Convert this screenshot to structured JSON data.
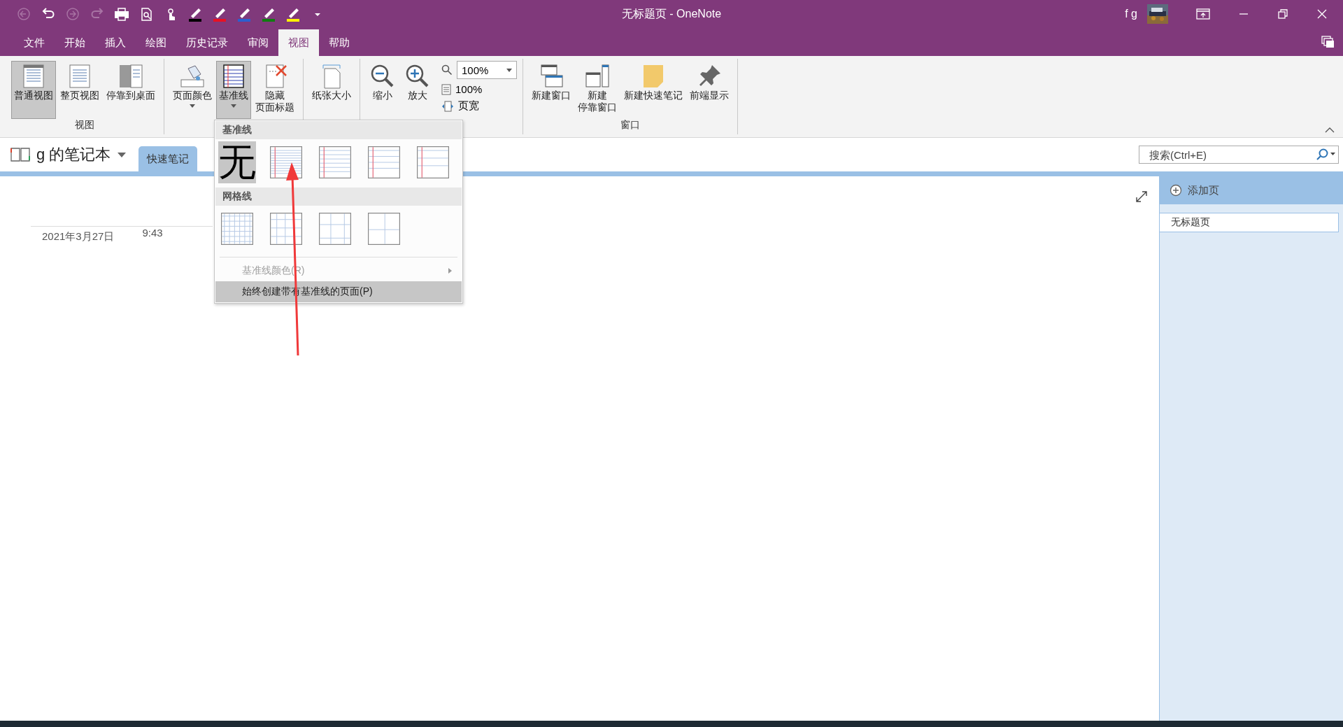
{
  "window": {
    "title": "无标题页 - OneNote",
    "user": "f g"
  },
  "quick_access": [
    {
      "kind": "back",
      "disabled": true
    },
    {
      "kind": "undo",
      "disabled": false
    },
    {
      "kind": "forward",
      "disabled": true
    },
    {
      "kind": "redo",
      "disabled": true
    },
    {
      "kind": "print",
      "disabled": false
    },
    {
      "kind": "preview",
      "disabled": false
    },
    {
      "kind": "touch",
      "disabled": false
    },
    {
      "kind": "pen",
      "color": "#000000"
    },
    {
      "kind": "pen",
      "color": "#e81123"
    },
    {
      "kind": "pen",
      "color": "#2b5fcf"
    },
    {
      "kind": "pen",
      "color": "#107c10"
    },
    {
      "kind": "pen",
      "color": "#fff100"
    },
    {
      "kind": "more",
      "disabled": false
    }
  ],
  "menu_tabs": [
    {
      "label": "文件",
      "selected": false
    },
    {
      "label": "开始",
      "selected": false
    },
    {
      "label": "插入",
      "selected": false
    },
    {
      "label": "绘图",
      "selected": false
    },
    {
      "label": "历史记录",
      "selected": false
    },
    {
      "label": "审阅",
      "selected": false
    },
    {
      "label": "视图",
      "selected": true
    },
    {
      "label": "帮助",
      "selected": false
    }
  ],
  "ribbon": {
    "groups": [
      {
        "label": "视图",
        "buttons": [
          {
            "kind": "normal",
            "lines": [
              "普通视图"
            ],
            "selected": true
          },
          {
            "kind": "fullpage",
            "lines": [
              "整页视图"
            ],
            "selected": false
          },
          {
            "kind": "dock",
            "lines": [
              "停靠到桌面"
            ],
            "selected": false
          }
        ]
      },
      {
        "buttons": [
          {
            "kind": "color",
            "lines": [
              "页面颜色"
            ],
            "selected": false,
            "menu": true
          },
          {
            "kind": "rules",
            "lines": [
              "基准线"
            ],
            "selected": true,
            "menu": true
          },
          {
            "kind": "hidetitle",
            "lines": [
              "隐藏",
              "页面标题"
            ],
            "selected": false
          }
        ]
      },
      {
        "buttons": [
          {
            "kind": "paper",
            "lines": [
              "纸张大小"
            ],
            "selected": false
          }
        ]
      },
      {
        "buttons": [
          {
            "kind": "zoomout",
            "lines": [
              "缩小"
            ],
            "selected": false
          },
          {
            "kind": "zoomin",
            "lines": [
              "放大"
            ],
            "selected": false
          }
        ],
        "zoom": {
          "value": "100%",
          "actual": "100%",
          "width": "页宽"
        }
      },
      {
        "label": "窗口",
        "buttons": [
          {
            "kind": "newwin",
            "lines": [
              "新建窗口"
            ],
            "selected": false
          },
          {
            "kind": "dockwin",
            "lines": [
              "新建",
              "停靠窗口"
            ],
            "selected": false
          },
          {
            "kind": "sticky",
            "lines": [
              "新建快速笔记"
            ],
            "selected": false
          },
          {
            "kind": "pin",
            "lines": [
              "前端显示"
            ],
            "selected": false
          }
        ]
      }
    ]
  },
  "notebook": {
    "name": "g 的笔记本",
    "sections": [
      {
        "label": "快速笔记",
        "selected": true
      }
    ]
  },
  "search": {
    "placeholder": "搜索(Ctrl+E)"
  },
  "pages_pane": {
    "add_page": "添加页",
    "pages": [
      {
        "title": "无标题页",
        "selected": true
      }
    ]
  },
  "page": {
    "date": "2021年3月27日",
    "time": "9:43"
  },
  "rule_menu": {
    "rules_header": "基准线",
    "rules": [
      {
        "kind": "text",
        "label": "无",
        "selected": true
      },
      {
        "kind": "lines",
        "selected": false
      },
      {
        "kind": "lines",
        "selected": false
      },
      {
        "kind": "lines",
        "selected": false
      },
      {
        "kind": "lines",
        "selected": false
      }
    ],
    "grid_header": "网格线",
    "grids": [
      {
        "selected": false
      },
      {
        "selected": false
      },
      {
        "selected": false
      },
      {
        "selected": false
      }
    ],
    "items": [
      {
        "label": "基准线颜色(R)",
        "disabled": true,
        "submenu": true,
        "highlighted": false
      },
      {
        "label": "始终创建带有基准线的页面(P)",
        "disabled": false,
        "submenu": false,
        "highlighted": true
      }
    ]
  }
}
